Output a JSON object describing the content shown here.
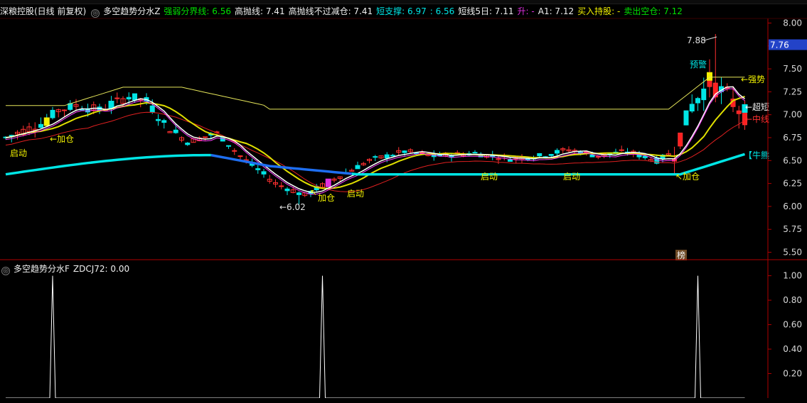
{
  "main_header": {
    "stock": "深粮控股(日线 前复权)",
    "indicator_name": "多空趋势分水Z",
    "items": [
      {
        "label": "强弱分界线:",
        "value": "6.56",
        "color": "#00e000"
      },
      {
        "label": "高抛线:",
        "value": "7.41",
        "color": "#f0f0f0"
      },
      {
        "label": "高抛线不过减仓:",
        "value": "7.41",
        "color": "#f0f0f0"
      },
      {
        "label": "短支撑:",
        "value": "6.97",
        "color": "#00e5e5"
      },
      {
        "label": ":",
        "value": "6.56",
        "color": "#00e5e5"
      },
      {
        "label": "短线5日:",
        "value": "7.11",
        "color": "#f0f0f0"
      },
      {
        "label": "升:",
        "value": "-",
        "color": "#e030e0"
      },
      {
        "label": "A1:",
        "value": "7.12",
        "color": "#f0f0f0"
      },
      {
        "label": "买入持股:",
        "value": "-",
        "color": "#f0f000"
      },
      {
        "label": "卖出空仓:",
        "value": "7.12",
        "color": "#00e000"
      }
    ]
  },
  "sub_header": {
    "indicator_name": "多空趋势分水F",
    "items": [
      {
        "label": "ZDCJ72:",
        "value": "0.00",
        "color": "#f0f0f0"
      }
    ]
  },
  "main_axis_ticks": [
    "8.00",
    "7.75",
    "7.50",
    "7.25",
    "7.00",
    "6.75",
    "6.50",
    "6.25",
    "6.00",
    "5.75",
    "5.50"
  ],
  "current_price_label": "7.76",
  "sub_axis_ticks": [
    "1.00",
    "0.80",
    "0.60",
    "0.40",
    "0.20"
  ],
  "annotations": {
    "high_price": "7.88",
    "low_price": "6.02",
    "start_1": "启动",
    "start_2": "启动",
    "start_3": "启动",
    "start_4": "启动",
    "add_1": "加仓",
    "add_2": "加仓",
    "add_3": "加仓",
    "warning": "预警",
    "strong": "强势",
    "super_short": "超短",
    "mid_line": "中线",
    "bull_bear": "【牛熊",
    "bang": "榜"
  },
  "colors": {
    "up": "#ff3030",
    "down": "#00e5e5",
    "bg": "#000000",
    "axis": "#b00000",
    "trend_line": "#00e5e5",
    "trend_blue": "#1e6ef0",
    "upper_band": "#e6e65a",
    "red_band": "#e02020"
  },
  "chart_data": [
    {
      "type": "candlestick",
      "title": "多空趋势分水Z",
      "ylim": [
        5.45,
        8.05
      ],
      "ticks": [
        8.0,
        7.75,
        7.5,
        7.25,
        7.0,
        6.75,
        6.5,
        6.25,
        6.0,
        5.75,
        5.5
      ],
      "n_bars": 127,
      "high": 7.88,
      "low": 6.02,
      "last_close": 7.0,
      "series": [
        {
          "name": "强弱分界线",
          "values": [
            6.35,
            6.4,
            6.45,
            6.5,
            6.54,
            6.56,
            6.57,
            6.56,
            6.53,
            6.48,
            6.43,
            6.39,
            6.36,
            6.35,
            6.35,
            6.35,
            6.35,
            6.35,
            6.35,
            6.35,
            6.35,
            6.35,
            6.35,
            6.4,
            6.5,
            6.56
          ]
        },
        {
          "name": "高抛线",
          "values": [
            7.1,
            7.12,
            7.25,
            7.28,
            7.3,
            7.27,
            7.2,
            7.12,
            7.06,
            7.05,
            7.06,
            7.06,
            7.06,
            7.06,
            7.06,
            7.06,
            7.06,
            7.06,
            7.07,
            7.08,
            7.41
          ]
        }
      ]
    },
    {
      "type": "line",
      "title": "多空趋势分水F",
      "series": [
        {
          "name": "ZDCJ72",
          "values": [
            0,
            1,
            0,
            0,
            1,
            0,
            0,
            1,
            0
          ]
        }
      ],
      "spikes_at_bar": [
        8,
        54,
        118
      ],
      "ylim": [
        0,
        1.05
      ],
      "ticks": [
        1.0,
        0.8,
        0.6,
        0.4,
        0.2
      ]
    }
  ]
}
